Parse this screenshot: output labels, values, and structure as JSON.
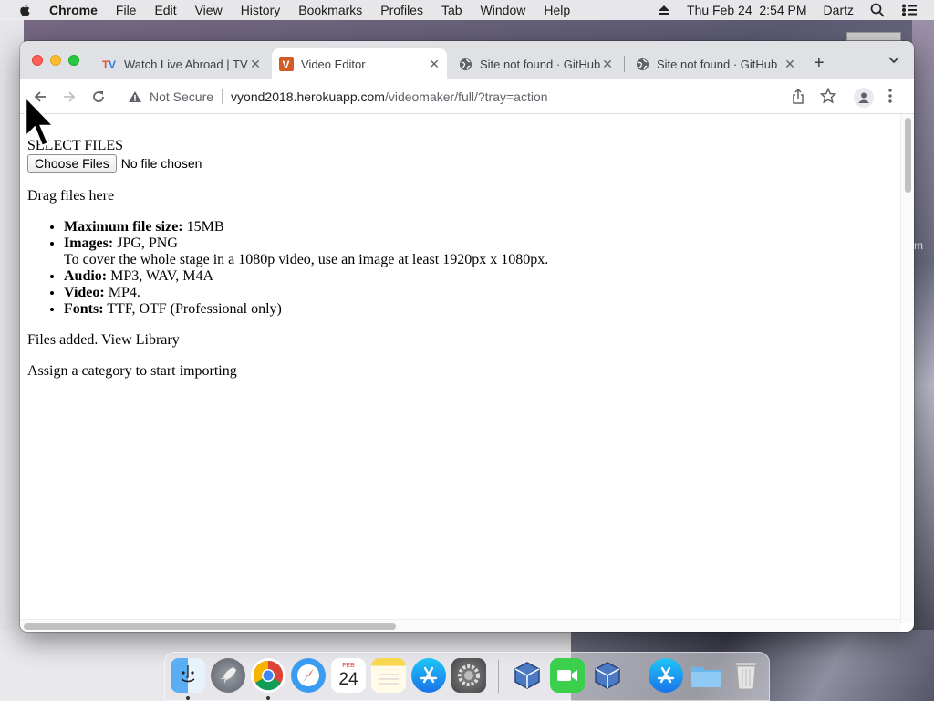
{
  "menubar": {
    "app_name": "Chrome",
    "items": [
      "File",
      "Edit",
      "View",
      "History",
      "Bookmarks",
      "Profiles",
      "Tab",
      "Window",
      "Help"
    ],
    "datetime": "Thu Feb 24  2:54 PM",
    "user": "Dartz"
  },
  "browser": {
    "tabs": [
      {
        "title": "Watch Live Abroad | TV",
        "favicon": "tv-logo-icon"
      },
      {
        "title": "Video Editor",
        "favicon": "vyond-v-icon"
      },
      {
        "title": "Site not found · GitHub",
        "favicon": "globe-icon"
      },
      {
        "title": "Site not found · GitHub",
        "favicon": "globe-icon"
      }
    ],
    "active_tab": 1,
    "address": {
      "security_label": "Not Secure",
      "host": "vyond2018.herokuapp.com",
      "path": "/videomaker/full/?tray=action"
    }
  },
  "page": {
    "title": "SELECT FILES",
    "choose_button": "Choose Files",
    "no_file": "No file chosen",
    "drag_text": "Drag files here",
    "requirements": [
      {
        "label": "Maximum file size:",
        "value": " 15MB"
      },
      {
        "label": "Images:",
        "value": " JPG, PNG",
        "note": "To cover the whole stage in a 1080p video, use an image at least 1920px x 1080px."
      },
      {
        "label": "Audio:",
        "value": " MP3, WAV, M4A"
      },
      {
        "label": "Video:",
        "value": " MP4."
      },
      {
        "label": "Fonts:",
        "value": " TTF, OTF (Professional only)"
      }
    ],
    "files_added": "Files added. View Library",
    "assign": "Assign a category to start importing"
  },
  "dock": {
    "calendar_month": "FEB",
    "calendar_day": "24"
  },
  "desktop": {
    "side_text": "m"
  }
}
